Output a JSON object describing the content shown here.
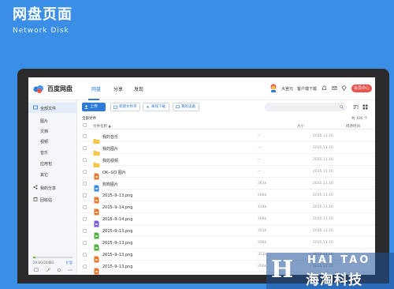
{
  "page": {
    "title": "网盘页面",
    "subtitle": "Network Disk"
  },
  "app": {
    "logo_text": "百度网盘",
    "nav_tabs": [
      {
        "label": "网盘",
        "active": true
      },
      {
        "label": "分享",
        "active": false
      },
      {
        "label": "发现",
        "active": false
      }
    ],
    "username": "大宫元",
    "client_link": "客户端下载",
    "upgrade_label": "会员中心"
  },
  "sidebar": {
    "items": [
      {
        "label": "全部文件",
        "icon": "folder-icon",
        "selected": true
      },
      {
        "label": "图片",
        "icon": null
      },
      {
        "label": "文档",
        "icon": null
      },
      {
        "label": "视频",
        "icon": null
      },
      {
        "label": "音乐",
        "icon": null
      },
      {
        "label": "应用包",
        "icon": null
      },
      {
        "label": "其它",
        "icon": null
      },
      {
        "label": "我的分享",
        "icon": "share-icon"
      },
      {
        "label": "回收站",
        "icon": "trash-icon"
      }
    ],
    "quota_text": "20.6G/2048G",
    "quota_fraction": 0.01,
    "expand_label": "扩容"
  },
  "toolbar": {
    "upload_label": "上传",
    "new_folder_label": "新建文件夹",
    "offline_download_label": "离线下载",
    "my_devices_label": "我的设备",
    "search_placeholder": ""
  },
  "list": {
    "breadcrumb": "全部文件",
    "count": "共 100 个",
    "columns": {
      "name": "文件名称",
      "size": "大小",
      "date": "修改时间"
    },
    "rows": [
      {
        "name": "我的音乐",
        "type": "folder",
        "size": "—",
        "date": "2015.11.10"
      },
      {
        "name": "我的图片",
        "type": "folder",
        "size": "—",
        "date": "2015.11.10"
      },
      {
        "name": "我的视频",
        "type": "folder",
        "size": "—",
        "date": "2015.11.10"
      },
      {
        "name": "OK--GO 图片",
        "type": "image",
        "size": "—",
        "date": "2015.11.10"
      },
      {
        "name": "狗狗图片",
        "type": "doc",
        "size": "361k",
        "date": "2015.11.10"
      },
      {
        "name": "2015–9–13.png",
        "type": "image",
        "size": "266k",
        "date": "2015.11.10"
      },
      {
        "name": "2015–9–14.png",
        "type": "image",
        "size": "134k",
        "date": "2015.11.10"
      },
      {
        "name": "2015–9–14.png",
        "type": "video",
        "size": "266k",
        "date": "2015.11.10"
      },
      {
        "name": "2015–9–13.png",
        "type": "green",
        "size": "353k",
        "date": "2015.11.10"
      },
      {
        "name": "2015–9–13.png",
        "type": "green",
        "size": "266k",
        "date": "2015.11.10"
      },
      {
        "name": "2015–9–13.png",
        "type": "image",
        "size": "353k",
        "date": "2015.11.10"
      },
      {
        "name": "2015–9–13.png",
        "type": "image",
        "size": "266k",
        "date": "2015.11.10"
      }
    ]
  },
  "watermark": {
    "letter": "H",
    "english": "HAI TAO",
    "chinese": "海淘科技"
  },
  "colors": {
    "background": "#3a8ee6",
    "accent": "#2e7bd7",
    "upgrade": "#e8534b",
    "folder": "#f5c64a",
    "image_file": "#e8782e",
    "video_file": "#7a5ae0",
    "green_file": "#52b043",
    "doc_file": "#3c8ae5"
  }
}
